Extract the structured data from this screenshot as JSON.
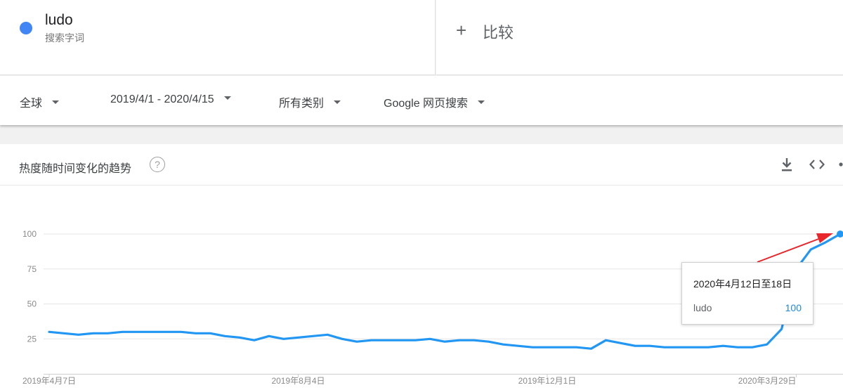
{
  "term": {
    "name": "ludo",
    "subtitle": "搜索字词",
    "color": "#4285f4"
  },
  "compare": {
    "label": "比较",
    "icon": "plus-icon"
  },
  "filters": {
    "region": "全球",
    "date_range": "2019/4/1 - 2020/4/15",
    "category": "所有类别",
    "search_type": "Google 网页搜索"
  },
  "chart_header": {
    "title": "热度随时间变化的趋势",
    "help": "?",
    "icons": [
      "download-icon",
      "embed-code-icon",
      "share-icon"
    ]
  },
  "tooltip": {
    "date": "2020年4月12日至18日",
    "series": "ludo",
    "value": "100"
  },
  "chart_data": {
    "type": "line",
    "title": "热度随时间变化的趋势",
    "ylim": [
      0,
      100
    ],
    "yticks": [
      25,
      50,
      75,
      100
    ],
    "grid": true,
    "x_tick_labels": [
      "2019年4月7日",
      "2019年8月4日",
      "2019年12月1日",
      "2020年3月29日"
    ],
    "x_tick_indices": [
      0,
      17,
      34,
      51
    ],
    "line_color": "#2196f3",
    "annotation_color": "#e8262b",
    "series": [
      {
        "name": "ludo",
        "values": [
          30,
          29,
          28,
          29,
          29,
          30,
          30,
          30,
          30,
          30,
          29,
          29,
          27,
          26,
          24,
          27,
          25,
          26,
          27,
          28,
          25,
          23,
          24,
          24,
          24,
          24,
          25,
          23,
          24,
          24,
          23,
          21,
          20,
          19,
          19,
          19,
          19,
          18,
          24,
          22,
          20,
          20,
          19,
          19,
          19,
          19,
          20,
          19,
          19,
          21,
          32,
          75,
          89,
          94,
          100
        ]
      }
    ]
  }
}
